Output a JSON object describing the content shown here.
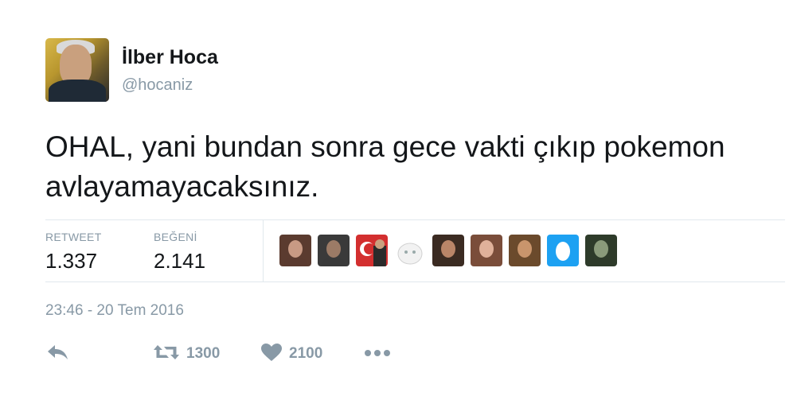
{
  "user": {
    "display_name": "İlber Hoca",
    "handle": "@hocaniz"
  },
  "tweet": {
    "text": "OHAL, yani bundan sonra gece vakti çıkıp pokemon avlayamayacaksınız.",
    "timestamp": "23:46 - 20 Tem 2016"
  },
  "stats": {
    "retweet_label": "RETWEET",
    "retweet_value": "1.337",
    "like_label": "BEĞENİ",
    "like_value": "2.141"
  },
  "likers": [
    {
      "icon": "user-avatar",
      "colors": [
        "#5b3b2f",
        "#c89a84"
      ]
    },
    {
      "icon": "user-avatar",
      "colors": [
        "#3a3a3a",
        "#9c7b66"
      ]
    },
    {
      "icon": "turkish-flag-avatar",
      "colors": [
        "#d32f2f",
        "#ffffff"
      ]
    },
    {
      "icon": "white-cat-avatar",
      "colors": [
        "#f2f2f2",
        "#d0d0d0"
      ]
    },
    {
      "icon": "user-avatar",
      "colors": [
        "#3b2b22",
        "#b98568"
      ]
    },
    {
      "icon": "user-avatar",
      "colors": [
        "#7a4d3a",
        "#e0b19a"
      ]
    },
    {
      "icon": "user-avatar",
      "colors": [
        "#6b4a2c",
        "#c9956c"
      ]
    },
    {
      "icon": "default-egg-avatar",
      "colors": [
        "#1da1f2",
        "#ffffff"
      ]
    },
    {
      "icon": "user-avatar",
      "colors": [
        "#2e3b2a",
        "#8a9a7a"
      ]
    }
  ],
  "actions": {
    "retweet_count": "1300",
    "like_count": "2100"
  }
}
